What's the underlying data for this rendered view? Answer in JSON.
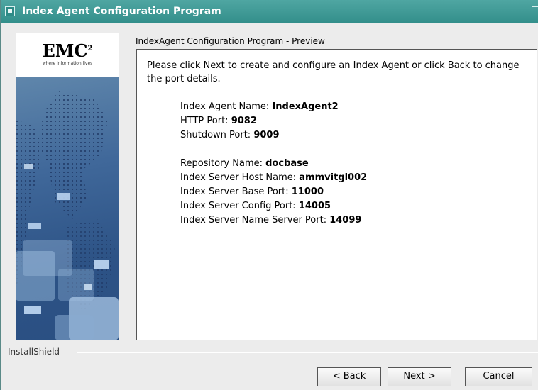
{
  "window": {
    "title": "Index Agent Configuration Program"
  },
  "logo": {
    "brand": "EMC",
    "superscript": "2",
    "tagline": "where information lives"
  },
  "page": {
    "section_title": "IndexAgent Configuration Program - Preview",
    "intro": "Please click Next to create and configure an Index Agent or click Back to change the port details."
  },
  "agent": {
    "name_label": "Index Agent Name: ",
    "name_value": "IndexAgent2",
    "http_label": "HTTP Port: ",
    "http_value": "9082",
    "shutdown_label": "Shutdown Port: ",
    "shutdown_value": "9009"
  },
  "server": {
    "repository_label": "Repository Name: ",
    "repository_value": "docbase",
    "host_label": "Index Server Host Name: ",
    "host_value": "ammvitgl002",
    "base_port_label": "Index Server Base Port: ",
    "base_port_value": "11000",
    "config_port_label": "Index Server Config Port: ",
    "config_port_value": "14005",
    "name_server_port_label": "Index Server Name Server Port: ",
    "name_server_port_value": "14099"
  },
  "footer": {
    "installshield_label": "InstallShield",
    "back_label": "< Back",
    "next_label": "Next >",
    "cancel_label": "Cancel"
  },
  "colors": {
    "titlebar": "#3a9894",
    "side_art_blue": "#2d5386"
  }
}
